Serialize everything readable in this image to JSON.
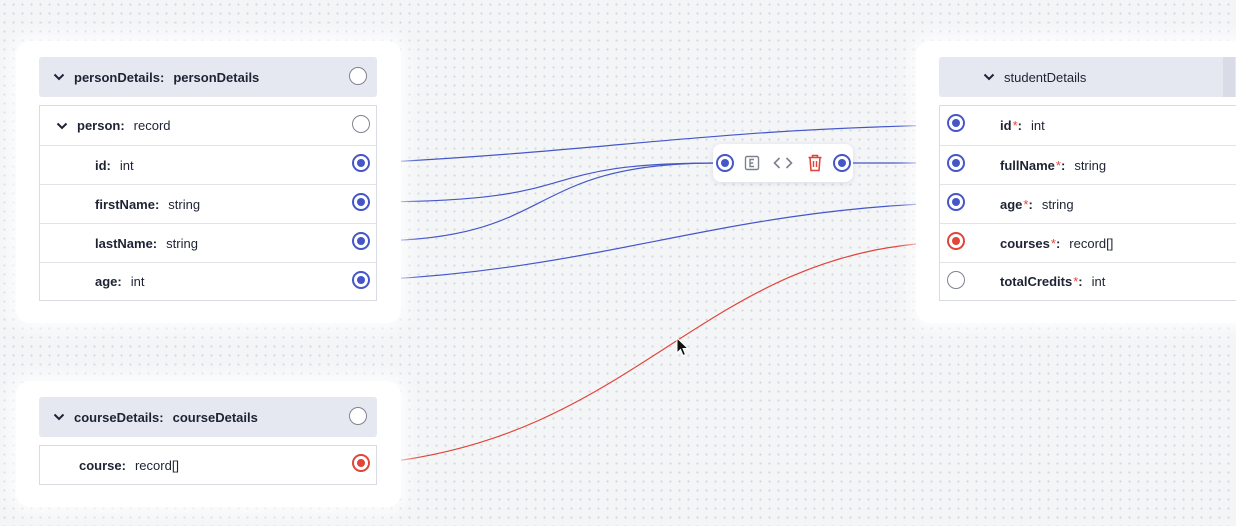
{
  "left_cards": {
    "person": {
      "header": {
        "key": "personDetails:",
        "type": "personDetails"
      },
      "record": {
        "key": "person:",
        "type": "record"
      },
      "fields": [
        {
          "key": "id:",
          "type": "int"
        },
        {
          "key": "firstName:",
          "type": "string"
        },
        {
          "key": "lastName:",
          "type": "string"
        },
        {
          "key": "age:",
          "type": "int"
        }
      ]
    },
    "course": {
      "header": {
        "key": "courseDetails:",
        "type": "courseDetails"
      },
      "fields": [
        {
          "key": "course:",
          "type": "record[]"
        }
      ]
    }
  },
  "right_card": {
    "header": {
      "title": "studentDetails"
    },
    "fields": [
      {
        "key": "id",
        "required": "*",
        "colon": ":",
        "type": "int"
      },
      {
        "key": "fullName",
        "required": "*",
        "colon": ":",
        "type": "string"
      },
      {
        "key": "age",
        "required": "*",
        "colon": ":",
        "type": "string"
      },
      {
        "key": "courses",
        "required": "*",
        "colon": ":",
        "type": "record[]"
      },
      {
        "key": "totalCredits",
        "required": "*",
        "colon": ":",
        "type": "int"
      }
    ]
  },
  "toolbar": {
    "icons": [
      "expression-icon",
      "code-icon",
      "delete-icon"
    ]
  },
  "colors": {
    "link_blue": "#4556c9",
    "link_red": "#e0453a",
    "header_bg": "#e5e8f1"
  }
}
